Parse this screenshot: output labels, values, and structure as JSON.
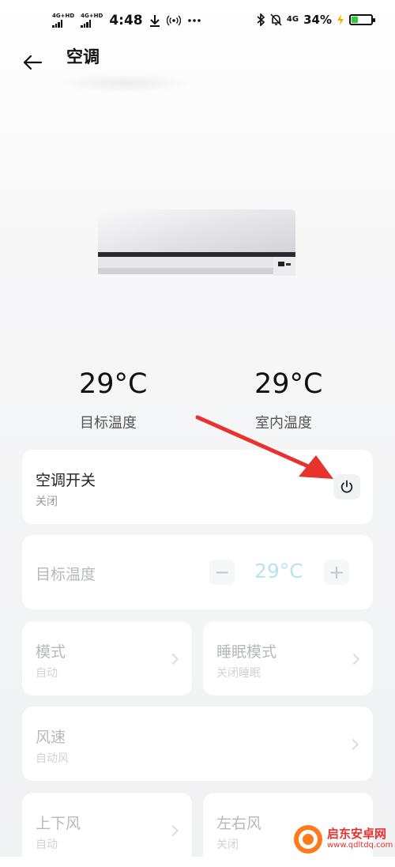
{
  "status_bar": {
    "net1": "4G+HD",
    "net2": "4G+HD",
    "time": "4:48",
    "signal_4g": "4G",
    "battery_pct": "34%",
    "battery_level": 0.34
  },
  "header": {
    "title": "空调"
  },
  "temps": {
    "target_value": "29°C",
    "target_label": "目标温度",
    "indoor_value": "29°C",
    "indoor_label": "室内温度"
  },
  "power": {
    "title": "空调开关",
    "status": "关闭"
  },
  "target_control": {
    "label": "目标温度",
    "value": "29°C",
    "minus": "−",
    "plus": "+"
  },
  "mode": {
    "title": "模式",
    "value": "自动"
  },
  "sleep": {
    "title": "睡眠模式",
    "value": "关闭睡眠"
  },
  "fan": {
    "title": "风速",
    "value": "自动风"
  },
  "vertical_swing": {
    "title": "上下风",
    "value": "自动"
  },
  "horizontal_swing": {
    "title": "左右风",
    "value": "关闭"
  },
  "watermark": {
    "line1": "启东安卓网",
    "line2": "www.qdltdq.com"
  },
  "colors": {
    "accent_light": "#b9e4ef",
    "arrow": "#e8322d",
    "battery": "#2ecc40"
  }
}
